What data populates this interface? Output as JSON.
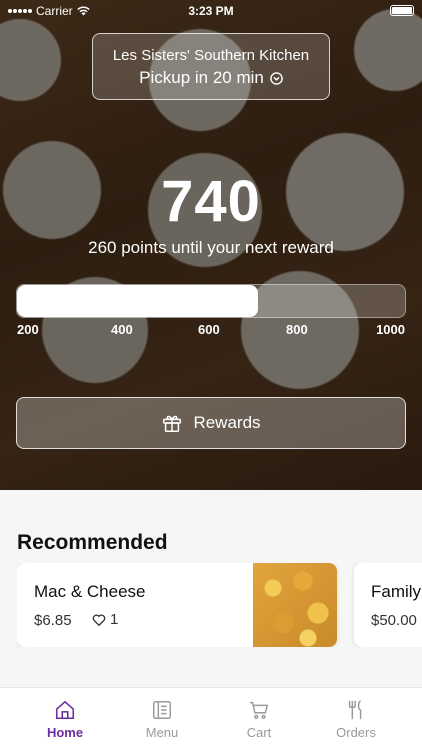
{
  "status_bar": {
    "carrier": "Carrier",
    "time": "3:23 PM"
  },
  "location": {
    "name": "Les Sisters' Southern Kitchen",
    "pickup": "Pickup in 20 min"
  },
  "loyalty": {
    "points": "740",
    "until_text": "260 points until your next reward",
    "progress_fraction": 0.62,
    "ticks": [
      "200",
      "400",
      "600",
      "800",
      "1000"
    ],
    "rewards_button": "Rewards"
  },
  "recommended": {
    "title": "Recommended",
    "items": [
      {
        "name": "Mac & Cheese",
        "price": "$6.85",
        "likes": "1"
      },
      {
        "name": "Family",
        "price": "$50.00"
      }
    ]
  },
  "tabs": [
    {
      "label": "Home",
      "icon": "home-icon",
      "active": true
    },
    {
      "label": "Menu",
      "icon": "menu-icon",
      "active": false
    },
    {
      "label": "Cart",
      "icon": "cart-icon",
      "active": false
    },
    {
      "label": "Orders",
      "icon": "orders-icon",
      "active": false
    }
  ],
  "colors": {
    "accent": "#6b2fa0",
    "tab_inactive": "#9a9a9a"
  }
}
